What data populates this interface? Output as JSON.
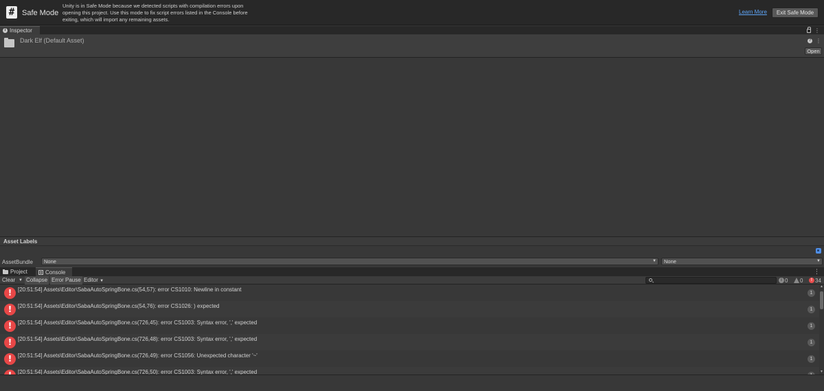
{
  "banner": {
    "icon_glyph": "#",
    "title": "Safe Mode",
    "message": "Unity is in Safe Mode because we detected scripts with compilation errors upon opening this project. Use this mode to fix script errors listed in the Console before exiting, which will import any remaining assets.",
    "learn_more": "Learn More",
    "exit_button": "Exit Safe Mode"
  },
  "inspector": {
    "tab_label": "Inspector",
    "asset_title": "Dark Elf (Default Asset)",
    "open_button": "Open",
    "more_glyph": "⋮",
    "help_glyph": "?"
  },
  "asset_labels": {
    "title": "Asset Labels",
    "bundle_label": "AssetBundle",
    "bundle_value": "None",
    "variant_value": "None"
  },
  "bottom_tabs": {
    "project": "Project",
    "console": "Console"
  },
  "console_toolbar": {
    "clear": "Clear",
    "collapse": "Collapse",
    "error_pause": "Error Pause",
    "editor": "Editor",
    "search_placeholder": "",
    "info_count": "0",
    "warning_count": "0",
    "error_count": "34"
  },
  "console_entries": [
    {
      "text": "[20:51:54] Assets\\Editor\\SabaAutoSpringBone.cs(54,57): error CS1010: Newline in constant",
      "count": "1"
    },
    {
      "text": "[20:51:54] Assets\\Editor\\SabaAutoSpringBone.cs(54,76): error CS1026: ) expected",
      "count": "1"
    },
    {
      "text": "[20:51:54] Assets\\Editor\\SabaAutoSpringBone.cs(726,45): error CS1003: Syntax error, ',' expected",
      "count": "1"
    },
    {
      "text": "[20:51:54] Assets\\Editor\\SabaAutoSpringBone.cs(726,48): error CS1003: Syntax error, ',' expected",
      "count": "1"
    },
    {
      "text": "[20:51:54] Assets\\Editor\\SabaAutoSpringBone.cs(726,49): error CS1056: Unexpected character '~'",
      "count": "1"
    },
    {
      "text": "[20:51:54] Assets\\Editor\\SabaAutoSpringBone.cs(726,50): error CS1003: Syntax error, ',' expected",
      "count": "1"
    }
  ],
  "colors": {
    "error": "#e84747",
    "link": "#5ea4f5",
    "label_tag": "#4f8ee6"
  }
}
